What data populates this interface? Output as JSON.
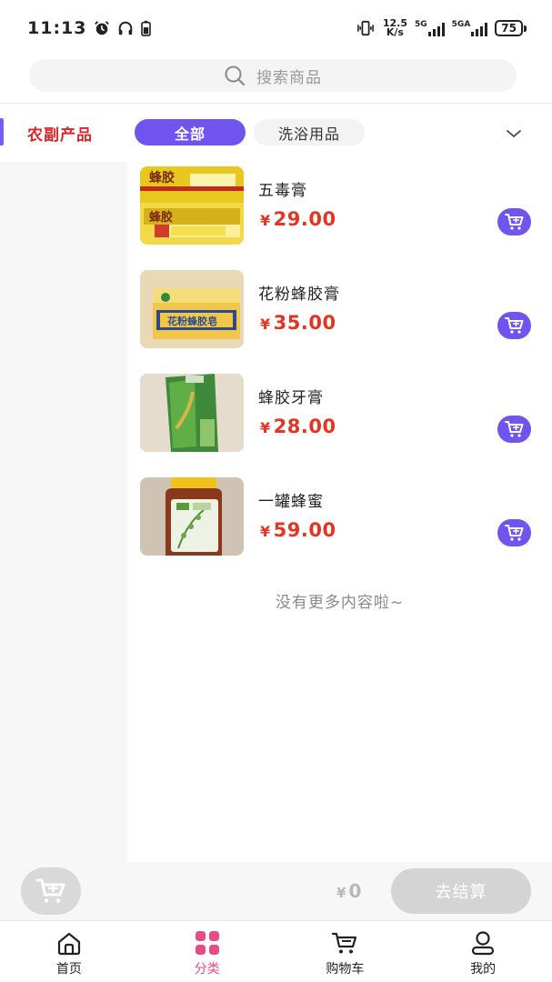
{
  "status_bar": {
    "time": "11:13",
    "net_speed_top": "12.5",
    "net_speed_bottom": "K/s",
    "sig1_label": "5G",
    "sig2_label": "5GA",
    "battery": "75"
  },
  "search": {
    "placeholder": "搜索商品"
  },
  "sidebar": {
    "items": [
      {
        "label": "农副产品",
        "active": true
      }
    ]
  },
  "tabs": [
    {
      "label": "全部",
      "active": true
    },
    {
      "label": "洗浴用品",
      "active": false
    }
  ],
  "products": [
    {
      "name": "五毒膏",
      "currency": "¥",
      "price": "29.00",
      "image_icon": "propolis-ointment-image"
    },
    {
      "name": "花粉蜂胶膏",
      "currency": "¥",
      "price": "35.00",
      "image_icon": "pollen-propolis-box-image"
    },
    {
      "name": "蜂胶牙膏",
      "currency": "¥",
      "price": "28.00",
      "image_icon": "propolis-toothpaste-image"
    },
    {
      "name": "一罐蜂蜜",
      "currency": "¥",
      "price": "59.00",
      "image_icon": "honey-jar-image"
    }
  ],
  "list_end_text": "没有更多内容啦~",
  "cart_bar": {
    "currency": "¥",
    "total": "0",
    "checkout_label": "去结算"
  },
  "bottom_nav": [
    {
      "label": "首页",
      "icon": "home-icon",
      "active": false
    },
    {
      "label": "分类",
      "icon": "category-icon",
      "active": true
    },
    {
      "label": "购物车",
      "icon": "cart-icon",
      "active": false
    },
    {
      "label": "我的",
      "icon": "user-icon",
      "active": false
    }
  ],
  "colors": {
    "accent": "#6f55ee",
    "price": "#e53424",
    "sidebar_active": "#d9262a",
    "nav_active": "#e94b8a"
  }
}
